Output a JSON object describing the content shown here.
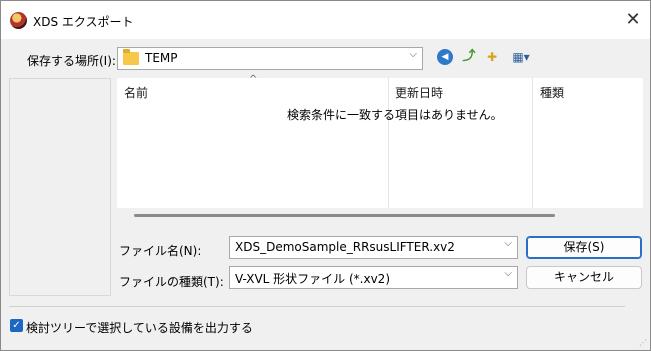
{
  "window": {
    "title": "XDS エクスポート",
    "close_glyph": "✕"
  },
  "location": {
    "label": "保存する場所(I):",
    "value": "TEMP",
    "arrow": "⌵"
  },
  "toolbar": {
    "back_glyph": "◀",
    "up_glyph": "⤴",
    "newfolder_glyph": "✚",
    "view_glyph": "▦▾"
  },
  "filelist": {
    "columns": [
      "名前",
      "更新日時",
      "種類"
    ],
    "sort_caret": "^",
    "empty_message": "検索条件に一致する項目はありません。"
  },
  "filename": {
    "label": "ファイル名(N):",
    "value": "XDS_DemoSample_RRsusLIFTER.xv2",
    "arrow": "⌵"
  },
  "filetype": {
    "label": "ファイルの種類(T):",
    "value": "V-XVL 形状ファイル (*.xv2)",
    "arrow": "⌵"
  },
  "buttons": {
    "save": "保存(S)",
    "cancel": "キャンセル"
  },
  "option": {
    "checked": true,
    "check_glyph": "✓",
    "label": "検討ツリーで選択している設備を出力する"
  },
  "colors": {
    "accent": "#1d67c4",
    "folder": "#f5c84a"
  }
}
